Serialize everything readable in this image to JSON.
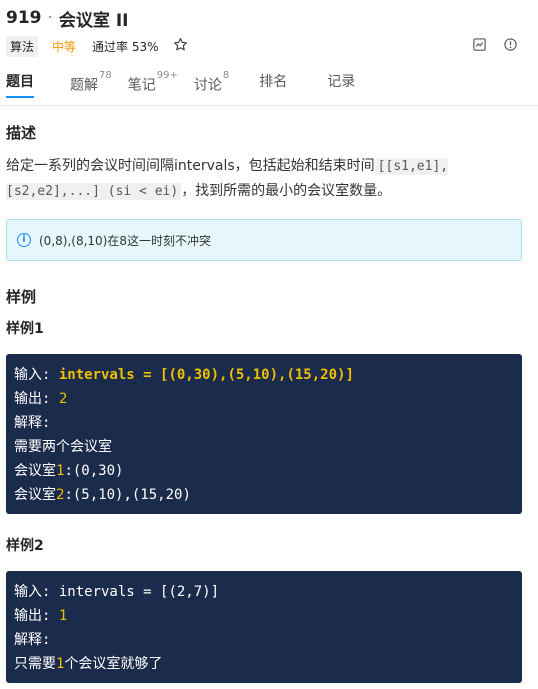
{
  "problem": {
    "number": "919",
    "separator": "·",
    "title": "会议室 II"
  },
  "meta": {
    "category": "算法",
    "difficulty": "中等",
    "pass_rate": "通过率 53%",
    "icons": [
      "star-icon",
      "export-icon",
      "alert-icon"
    ]
  },
  "tabs": [
    {
      "label": "题目",
      "count": ""
    },
    {
      "label": "题解",
      "count": "78"
    },
    {
      "label": "笔记",
      "count": "99+"
    },
    {
      "label": "讨论",
      "count": "8"
    },
    {
      "label": "排名",
      "count": ""
    },
    {
      "label": "记录",
      "count": ""
    }
  ],
  "description": {
    "heading": "描述",
    "text_before": "给定一系列的会议时间间隔intervals，包括起始和结束时间",
    "code": "[[s1,e1],[s2,e2],...] (si < ei)",
    "text_after": "，找到所需的最小的会议室数量。"
  },
  "note": "(0,8),(8,10)在8这一时刻不冲突",
  "examples": {
    "heading": "样例",
    "items": [
      {
        "title": "样例1",
        "lines": {
          "input_label": "输入: ",
          "input_key": "intervals",
          "input_eq": " = ",
          "input_value": "[(0,30),(5,10),(15,20)]",
          "output_label": "输出: ",
          "output_value": "2",
          "explain_label": "解释:",
          "explain_1": "需要两个会议室",
          "explain_2_prefix": "会议室",
          "explain_2_num": "1",
          "explain_2_value": ":(0,30)",
          "explain_3_prefix": "会议室",
          "explain_3_num": "2",
          "explain_3_value": ":(5,10),(15,20)"
        }
      },
      {
        "title": "样例2",
        "lines": {
          "input_label": "输入: ",
          "input_key": "intervals",
          "input_eq": " = ",
          "input_value": "[(2,7)]",
          "output_label": "输出: ",
          "output_value": "1",
          "explain_label": "解释:",
          "explain_1_prefix": "只需要",
          "explain_1_num": "1",
          "explain_1_suffix": "个会议室就够了"
        }
      }
    ]
  },
  "colors": {
    "accent": "#1890ff",
    "difficulty_medium": "#ff9500",
    "code_bg": "#1b2b4b",
    "code_highlight": "#f0c000"
  }
}
